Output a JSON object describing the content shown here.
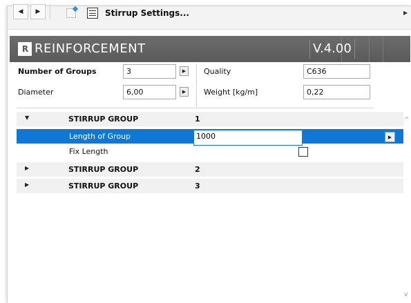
{
  "toolbar": {
    "back_icon": "triangle-left-icon",
    "forward_icon": "triangle-right-icon",
    "title": "Stirrup Settings...",
    "glyph_left": "◀",
    "glyph_right": "▶"
  },
  "banner": {
    "logo": "R",
    "brand": "REINFORCEMENT",
    "version": "V.4.00"
  },
  "params": {
    "groups_label": "Number of Groups",
    "groups_value": "3",
    "diameter_label": "Diameter",
    "diameter_value": "6,00",
    "quality_label": "Quality",
    "quality_value": "C636",
    "weight_label": "Weight [kg/m]",
    "weight_value": "0,22",
    "stepper_glyph": "▶"
  },
  "tree": {
    "expanded_glyph": "▼",
    "collapsed_glyph": "▶",
    "groups": [
      {
        "label": "STIRRUP GROUP",
        "number": "1"
      },
      {
        "label": "STIRRUP GROUP",
        "number": "2"
      },
      {
        "label": "STIRRUP GROUP",
        "number": "3"
      }
    ],
    "length_label": "Length of Group",
    "length_value": "1000",
    "fix_label": "Fix Length",
    "fix_checked": false
  },
  "scrollbar": {
    "up": "^",
    "down": "v"
  },
  "colors": {
    "selection": "#0f78d4",
    "banner": "#626262",
    "group_header_bg": "#f0f0f0"
  }
}
